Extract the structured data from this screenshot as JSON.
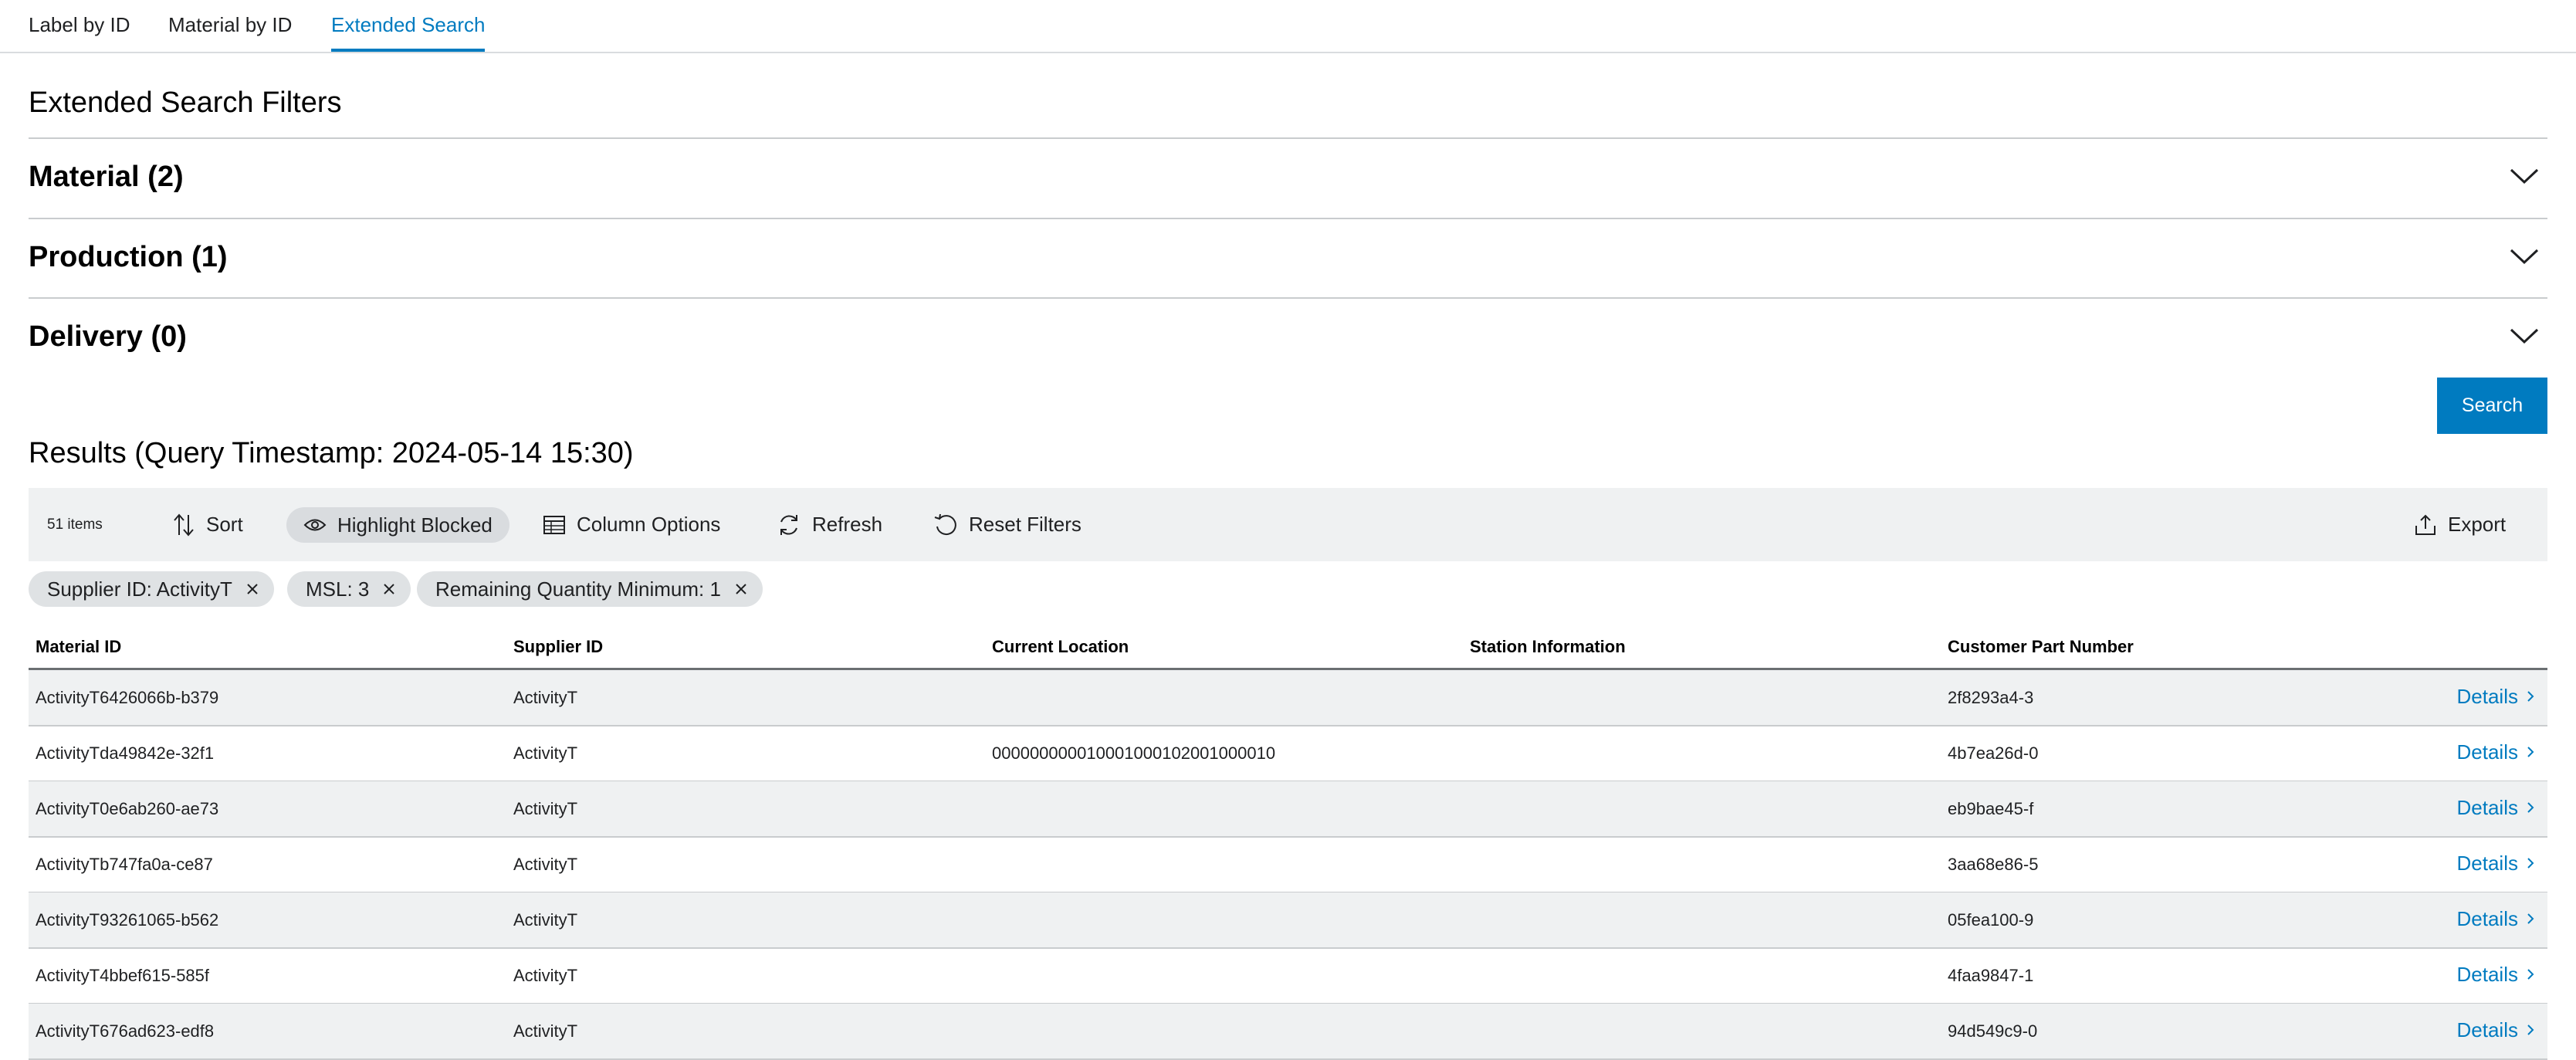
{
  "tabs": [
    {
      "label": "Label by ID"
    },
    {
      "label": "Material by ID"
    },
    {
      "label": "Extended Search",
      "active": true
    }
  ],
  "filters": {
    "title": "Extended Search Filters",
    "sections": [
      {
        "label": "Material (2)"
      },
      {
        "label": "Production (1)"
      },
      {
        "label": "Delivery (0)"
      }
    ],
    "search_label": "Search"
  },
  "results": {
    "title": "Results (Query Timestamp: 2024-05-14 15:30)",
    "count": "51 items",
    "toolbar": {
      "sort": "Sort",
      "highlight_blocked": "Highlight Blocked",
      "column_options": "Column Options",
      "refresh": "Refresh",
      "reset_filters": "Reset Filters",
      "export": "Export"
    },
    "chips": [
      "Supplier ID: ActivityT",
      "MSL: 3",
      "Remaining Quantity Minimum: 1"
    ],
    "columns": [
      "Material ID",
      "Supplier ID",
      "Current Location",
      "Station Information",
      "Customer Part Number"
    ],
    "details_label": "Details",
    "rows": [
      {
        "material_id": "ActivityT6426066b-b379",
        "supplier_id": "ActivityT",
        "location": "",
        "station": "",
        "customer_part": "2f8293a4-3"
      },
      {
        "material_id": "ActivityTda49842e-32f1",
        "supplier_id": "ActivityT",
        "location": "000000000010001000102001000010",
        "station": "",
        "customer_part": "4b7ea26d-0"
      },
      {
        "material_id": "ActivityT0e6ab260-ae73",
        "supplier_id": "ActivityT",
        "location": "",
        "station": "",
        "customer_part": "eb9bae45-f"
      },
      {
        "material_id": "ActivityTb747fa0a-ce87",
        "supplier_id": "ActivityT",
        "location": "",
        "station": "",
        "customer_part": "3aa68e86-5"
      },
      {
        "material_id": "ActivityT93261065-b562",
        "supplier_id": "ActivityT",
        "location": "",
        "station": "",
        "customer_part": "05fea100-9"
      },
      {
        "material_id": "ActivityT4bbef615-585f",
        "supplier_id": "ActivityT",
        "location": "",
        "station": "",
        "customer_part": "4faa9847-1"
      },
      {
        "material_id": "ActivityT676ad623-edf8",
        "supplier_id": "ActivityT",
        "location": "",
        "station": "",
        "customer_part": "94d549c9-0"
      }
    ]
  },
  "colors": {
    "accent": "#007bc0",
    "toolbar_bg": "#eff1f2",
    "chip_bg": "#dfe2e4",
    "row_shade": "#eff1f2"
  }
}
